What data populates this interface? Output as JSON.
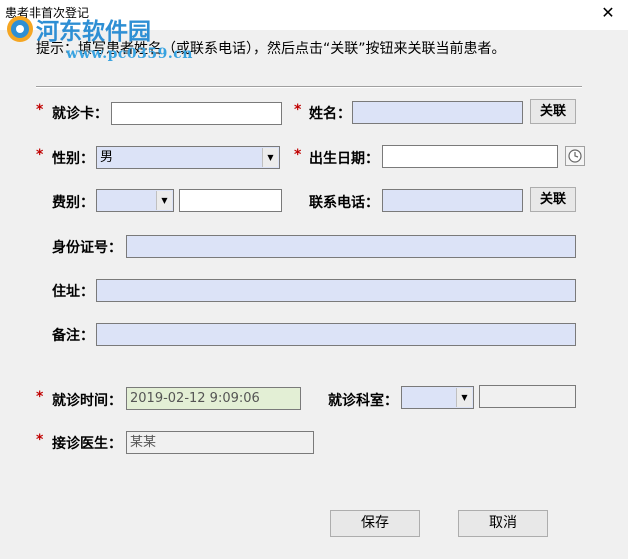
{
  "window": {
    "title": "患者非首次登记",
    "close_glyph": "✕"
  },
  "watermark": {
    "name": "河东软件园",
    "url": "www.pc0359.cn"
  },
  "hint": "提示：填写患者姓名（或联系电话），然后点击“关联”按钮来关联当前患者。",
  "required_mark": "*",
  "form": {
    "card": {
      "label": "就诊卡：",
      "value": ""
    },
    "name": {
      "label": "姓名：",
      "value": "",
      "link_button": "关联"
    },
    "gender": {
      "label": "性别：",
      "value": "男"
    },
    "birth": {
      "label": "出生日期：",
      "value": ""
    },
    "fee": {
      "label": "费别：",
      "value": "",
      "extra_value": ""
    },
    "phone": {
      "label": "联系电话：",
      "value": "",
      "link_button": "关联"
    },
    "id_no": {
      "label": "身份证号：",
      "value": ""
    },
    "address": {
      "label": "住址：",
      "value": ""
    },
    "remark": {
      "label": "备注：",
      "value": ""
    },
    "visit_time": {
      "label": "就诊时间：",
      "value": "2019-02-12  9:09:06"
    },
    "dept": {
      "label": "就诊科室：",
      "value": "",
      "extra_value": ""
    },
    "doctor": {
      "label": "接诊医生：",
      "value": "某某"
    }
  },
  "buttons": {
    "save": "保存",
    "cancel": "取消"
  },
  "colors": {
    "required": "#c00000",
    "required_field_bg": "#dce3f7",
    "time_field_bg": "#e3efd5",
    "watermark": "#2e8fd4"
  }
}
